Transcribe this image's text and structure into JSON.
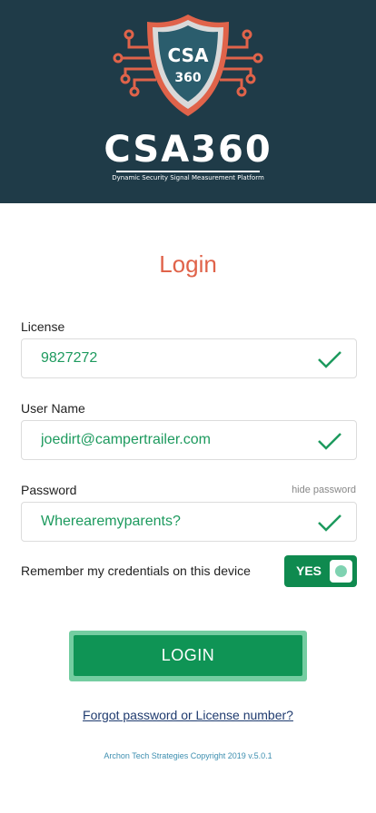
{
  "header": {
    "logo_text": "CSA 360",
    "brand_name": "CSA360",
    "tagline": "Dynamic Security Signal Measurement Platform"
  },
  "login": {
    "title": "Login",
    "license": {
      "label": "License",
      "value": "9827272"
    },
    "username": {
      "label": "User Name",
      "value": "joedirt@campertrailer.com"
    },
    "password": {
      "label": "Password",
      "value": "Wherearemyparents?",
      "hint": "hide password"
    },
    "remember": {
      "label": "Remember my credentials on this device",
      "toggle_text": "YES"
    },
    "button_label": "LOGIN",
    "forgot_link": "Forgot password or License number?",
    "copyright": "Archon Tech Strategies Copyright 2019 v.5.0.1"
  },
  "colors": {
    "header_bg": "#1f3b48",
    "accent_orange": "#e0634a",
    "valid_green": "#1d9a5e",
    "button_green": "#0f9455"
  },
  "icons": {
    "field_valid": "checkmark-icon",
    "logo": "shield-circuit-icon"
  }
}
